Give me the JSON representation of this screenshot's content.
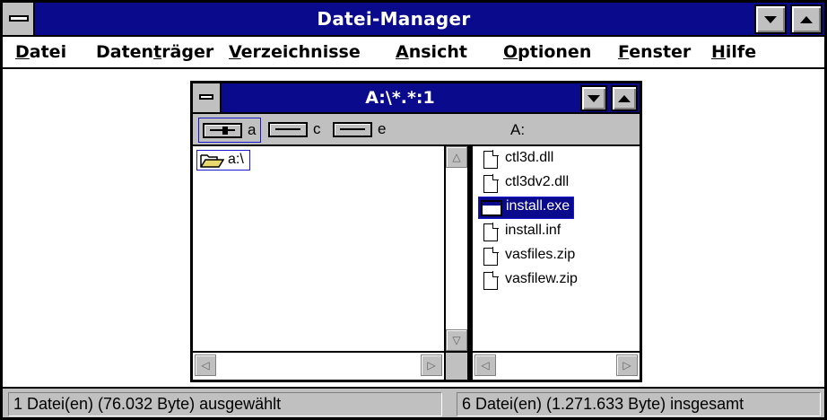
{
  "window": {
    "title": "Datei-Manager"
  },
  "menu": [
    {
      "label": "Datei",
      "accel": "D",
      "rest": "atei"
    },
    {
      "label": "Datenträger",
      "pre": "Daten",
      "accel": "t",
      "rest": "räger"
    },
    {
      "label": "Verzeichnisse",
      "accel": "V",
      "rest": "erzeichnisse"
    },
    {
      "label": "Ansicht",
      "accel": "A",
      "rest": "nsicht"
    },
    {
      "label": "Optionen",
      "accel": "O",
      "rest": "ptionen"
    },
    {
      "label": "Fenster",
      "accel": "F",
      "rest": "enster"
    },
    {
      "label": "Hilfe",
      "accel": "H",
      "rest": "ilfe"
    }
  ],
  "child_window": {
    "title": "A:\\*.*:1",
    "drives": [
      {
        "letter": "a",
        "type": "floppy",
        "selected": true
      },
      {
        "letter": "c",
        "type": "hard-disk",
        "selected": false
      },
      {
        "letter": "e",
        "type": "hard-disk",
        "selected": false
      }
    ],
    "current_drive_label": "A:",
    "tree": [
      {
        "label": "a:\\",
        "icon": "open-folder-icon",
        "selected": true
      }
    ],
    "files": [
      {
        "name": "ctl3d.dll",
        "icon": "document-icon",
        "selected": false
      },
      {
        "name": "ctl3dv2.dll",
        "icon": "document-icon",
        "selected": false
      },
      {
        "name": "install.exe",
        "icon": "program-icon",
        "selected": true
      },
      {
        "name": "install.inf",
        "icon": "document-icon",
        "selected": false
      },
      {
        "name": "vasfiles.zip",
        "icon": "document-icon",
        "selected": false
      },
      {
        "name": "vasfilew.zip",
        "icon": "document-icon",
        "selected": false
      }
    ]
  },
  "status": {
    "left": "1 Datei(en) (76.032 Byte) ausgewählt",
    "right": "6 Datei(en) (1.271.633 Byte) insgesamt"
  },
  "colors": {
    "title_bar": "#0a0a8c",
    "chrome": "#c0c0c0",
    "selection": "#0a0a8c",
    "selection_border": "#1a1acc"
  }
}
